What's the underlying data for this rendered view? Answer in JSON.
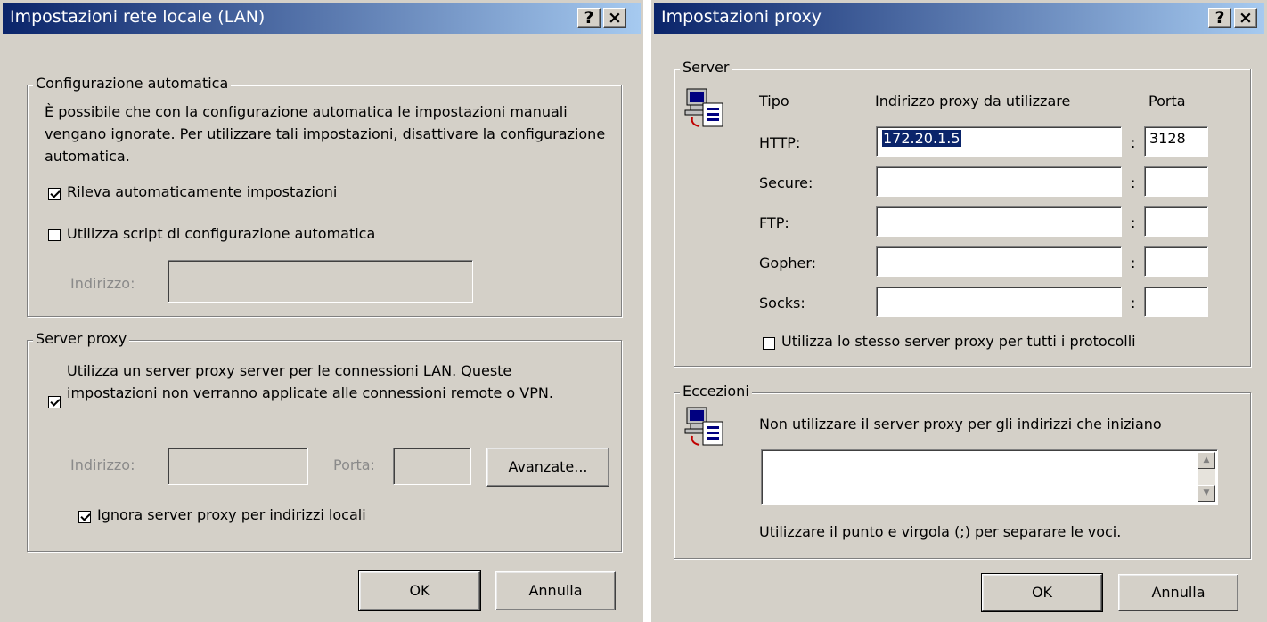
{
  "lan": {
    "title": "Impostazioni rete locale (LAN)",
    "help_label": "?",
    "close_label": "×",
    "auto_config": {
      "legend": "Configurazione automatica",
      "description": "È possibile che con la configurazione automatica le impostazioni manuali vengano ignorate. Per utilizzare tali impostazioni, disattivare la configurazione automatica.",
      "detect_label": "Rileva automaticamente impostazioni",
      "detect_checked": true,
      "script_label": "Utilizza script di configurazione automatica",
      "script_checked": false,
      "address_label": "Indirizzo:",
      "address_value": ""
    },
    "proxy_server": {
      "legend": "Server proxy",
      "use_proxy_label": "Utilizza un server proxy server per le connessioni LAN. Queste impostazioni non verranno applicate alle connessioni remote o VPN.",
      "use_proxy_checked": true,
      "address_label": "Indirizzo:",
      "address_value": "",
      "port_label": "Porta:",
      "port_value": "",
      "advanced_label": "Avanzate...",
      "bypass_label": "Ignora server proxy per indirizzi locali",
      "bypass_checked": true
    },
    "ok_label": "OK",
    "cancel_label": "Annulla"
  },
  "proxy": {
    "title": "Impostazioni proxy",
    "help_label": "?",
    "close_label": "×",
    "server": {
      "legend": "Server",
      "col_type": "Tipo",
      "col_address": "Indirizzo proxy da utilizzare",
      "col_port": "Porta",
      "separator": ":",
      "rows": [
        {
          "type": "HTTP:",
          "address": "172.20.1.5",
          "port": "3128"
        },
        {
          "type": "Secure:",
          "address": "",
          "port": ""
        },
        {
          "type": "FTP:",
          "address": "",
          "port": ""
        },
        {
          "type": "Gopher:",
          "address": "",
          "port": ""
        },
        {
          "type": "Socks:",
          "address": "",
          "port": ""
        }
      ],
      "same_proxy_label": "Utilizza lo stesso server proxy per tutti i protocolli",
      "same_proxy_checked": false
    },
    "exceptions": {
      "legend": "Eccezioni",
      "description": "Non utilizzare il server proxy per gli indirizzi che iniziano",
      "value": "",
      "hint": "Utilizzare il punto e virgola (;) per separare le voci."
    },
    "ok_label": "OK",
    "cancel_label": "Annulla"
  }
}
